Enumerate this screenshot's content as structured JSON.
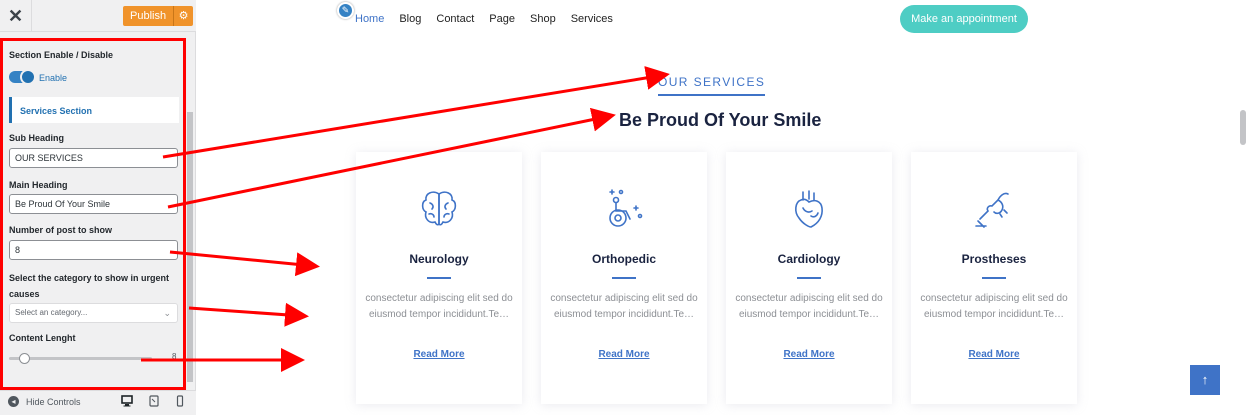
{
  "customizer": {
    "close_glyph": "✕",
    "publish_label": "Publish",
    "publish_gear_glyph": "⚙",
    "section_toggle_title": "Section Enable / Disable",
    "toggle_label": "Enable",
    "toggle_on": true,
    "section_name": "Services Section",
    "sub_heading_label": "Sub Heading",
    "sub_heading_value": "OUR SERVICES",
    "main_heading_label": "Main Heading",
    "main_heading_value": "Be Proud Of Your Smile",
    "num_posts_label": "Number of post to show",
    "num_posts_value": "8",
    "category_label": "Select the category to show in urgent causes",
    "category_placeholder": "Select an category...",
    "content_length_label": "Content Lenght",
    "content_length_value": "8",
    "hide_controls_label": "Hide Controls",
    "highlight_color": "#ff0000",
    "accent_color": "#2271b1"
  },
  "preview": {
    "nav": [
      "Home",
      "Blog",
      "Contact",
      "Page",
      "Shop",
      "Services"
    ],
    "appointment_button": "Make an appointment",
    "sub_heading": "OUR SERVICES",
    "main_heading": "Be Proud Of Your Smile",
    "cards": [
      {
        "title": "Neurology",
        "text": "consectetur adipiscing elit sed do eiusmod tempor incididunt.Te…",
        "link": "Read More",
        "icon": "brain-icon"
      },
      {
        "title": "Orthopedic",
        "text": "consectetur adipiscing elit sed do eiusmod tempor incididunt.Te…",
        "link": "Read More",
        "icon": "wheelchair-icon"
      },
      {
        "title": "Cardiology",
        "text": "consectetur adipiscing elit sed do eiusmod tempor incididunt.Te…",
        "link": "Read More",
        "icon": "heart-icon"
      },
      {
        "title": "Prostheses",
        "text": "consectetur adipiscing elit sed do eiusmod tempor incididunt.Te…",
        "link": "Read More",
        "icon": "prosthetic-hand-icon"
      }
    ],
    "scroll_top_glyph": "↑",
    "brand_color": "#3f73c7",
    "appointment_color": "#4ecdc4"
  }
}
